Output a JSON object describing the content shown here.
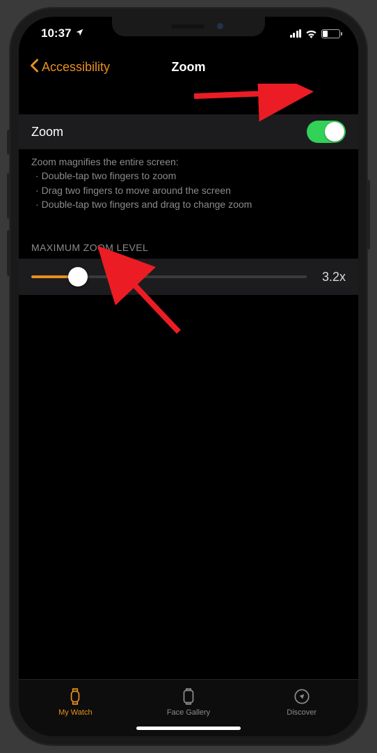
{
  "status": {
    "time": "10:37"
  },
  "nav": {
    "back_label": "Accessibility",
    "title": "Zoom"
  },
  "zoom_row": {
    "label": "Zoom",
    "enabled": true
  },
  "help": {
    "heading": "Zoom magnifies the entire screen:",
    "lines": [
      "Double-tap two fingers to zoom",
      "Drag two fingers to move around the screen",
      "Double-tap two fingers and drag to change zoom"
    ]
  },
  "slider": {
    "section_label": "MAXIMUM ZOOM LEVEL",
    "value_label": "3.2x",
    "percent": 17
  },
  "tabs": {
    "my_watch": "My Watch",
    "face_gallery": "Face Gallery",
    "discover": "Discover"
  }
}
